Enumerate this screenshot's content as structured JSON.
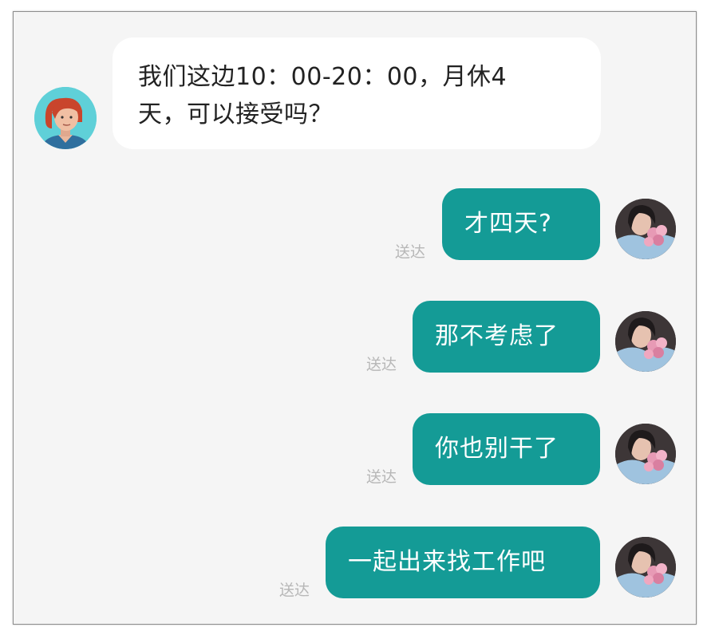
{
  "conversation": {
    "incoming": {
      "line1": "我们这边10：00-20：00，月休4",
      "line2": "天，可以接受吗？",
      "avatar_icon": "cartoon-person-avatar"
    },
    "outgoing": [
      {
        "text": "才四天?",
        "status": "送达"
      },
      {
        "text": "那不考虑了",
        "status": "送达"
      },
      {
        "text": "你也别干了",
        "status": "送达"
      },
      {
        "text": "一起出来找工作吧",
        "status": "送达"
      }
    ],
    "colors": {
      "outgoing_bubble": "#149b96",
      "incoming_bubble": "#ffffff",
      "background": "#f5f5f5",
      "status_text": "#b7b7b7"
    }
  }
}
